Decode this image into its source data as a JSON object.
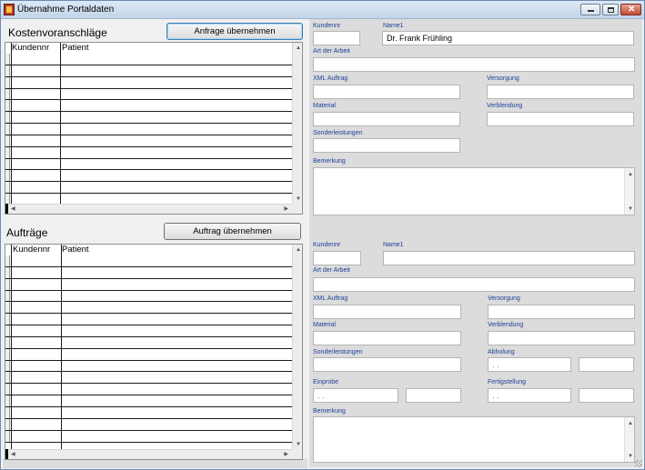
{
  "window": {
    "title": "Übernahme Portaldaten",
    "controls": {
      "minimize": "minimize-icon",
      "maximize": "maximize-icon",
      "close": "close-icon"
    }
  },
  "kostenvoranschlaege": {
    "title": "Kostenvoranschläge",
    "button": "Anfrage übernehmen",
    "columns": [
      "Kundennr",
      "Patient"
    ],
    "row_count": 13
  },
  "auftraege": {
    "title": "Aufträge",
    "button": "Auftrag übernehmen",
    "columns": [
      "Kundennr",
      "Patient"
    ],
    "row_count": 16
  },
  "anfrage_form": {
    "kundennr": {
      "label": "Kundennr",
      "value": ""
    },
    "name1": {
      "label": "Name1",
      "value": "Dr. Frank Frühling"
    },
    "art_der_arbeit": {
      "label": "Art der Arbeit",
      "value": ""
    },
    "xml_auftrag": {
      "label": "XML Auftrag",
      "value": ""
    },
    "versorgung": {
      "label": "Versorgung",
      "value": ""
    },
    "material": {
      "label": "Material",
      "value": ""
    },
    "verblendung": {
      "label": "Verblendung",
      "value": ""
    },
    "sonderleistungen": {
      "label": "Sonderleistungen",
      "value": ""
    },
    "bemerkung": {
      "label": "Bemerkung",
      "value": ""
    }
  },
  "auftrag_form": {
    "kundennr": {
      "label": "Kundennr",
      "value": ""
    },
    "name1": {
      "label": "Name1",
      "value": ""
    },
    "art_der_arbeit": {
      "label": "Art der Arbeit",
      "value": ""
    },
    "xml_auftrag": {
      "label": "XML Auftrag",
      "value": ""
    },
    "versorgung": {
      "label": "Versorgung",
      "value": ""
    },
    "material": {
      "label": "Material",
      "value": ""
    },
    "verblendung": {
      "label": "Verblendung",
      "value": ""
    },
    "sonderleistungen": {
      "label": "Sonderleistungen",
      "value": ""
    },
    "abholung": {
      "label": "Abholung",
      "date": " .  .",
      "time": ""
    },
    "einprobe": {
      "label": "Einprobe",
      "date": " .  .",
      "time": ""
    },
    "fertigstellung": {
      "label": "Fertigstellung",
      "date": " .  .",
      "time": ""
    },
    "bemerkung": {
      "label": "Bemerkung",
      "value": ""
    }
  },
  "colors": {
    "label_blue": "#1f3f9a",
    "panel_gray": "#dcdcdc",
    "window_bg": "#f0f0f0"
  }
}
